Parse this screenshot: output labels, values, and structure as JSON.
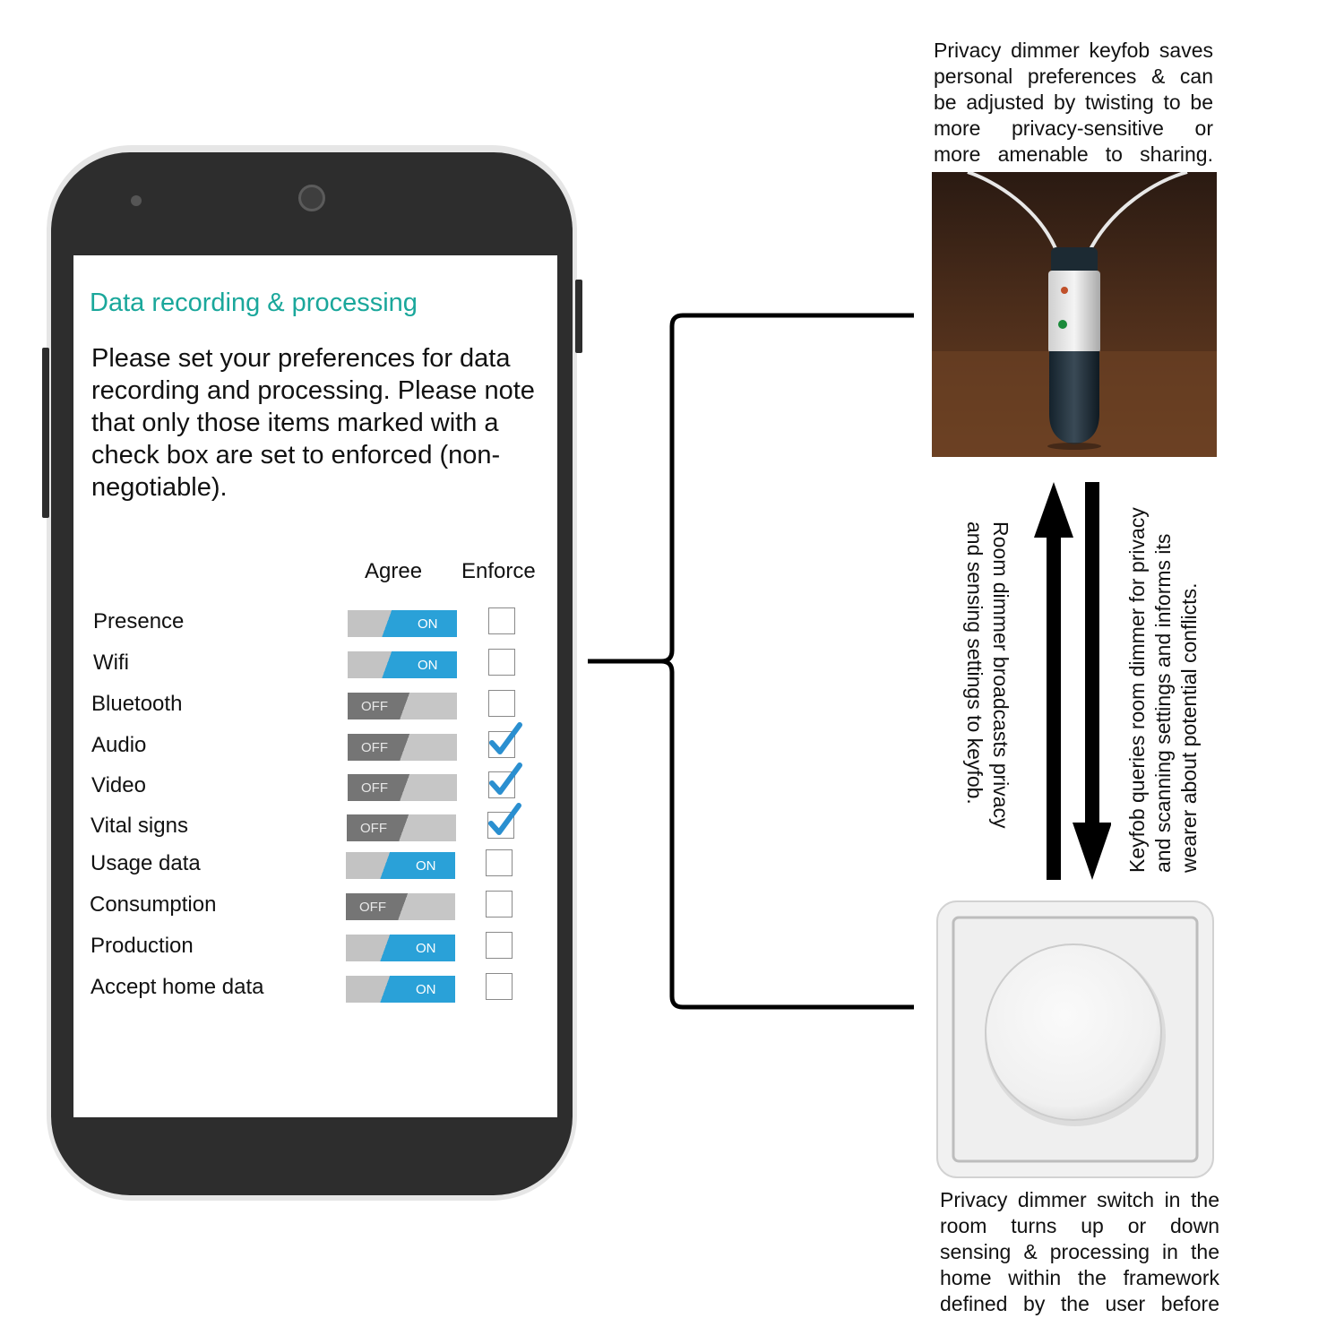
{
  "screen": {
    "title": "Data recording & processing",
    "description": "Please set your preferences for data recording and processing. Please note that only those items marked with a check box are set to enforced (non-negotiable).",
    "columns": {
      "agree": "Agree",
      "enforce": "Enforce"
    },
    "rows": [
      {
        "label": "Presence",
        "agree": "ON",
        "enforce": false
      },
      {
        "label": "Wifi",
        "agree": "ON",
        "enforce": false
      },
      {
        "label": "Bluetooth",
        "agree": "OFF",
        "enforce": false
      },
      {
        "label": "Audio",
        "agree": "OFF",
        "enforce": true
      },
      {
        "label": "Video",
        "agree": "OFF",
        "enforce": true
      },
      {
        "label": "Vital signs",
        "agree": "OFF",
        "enforce": true
      },
      {
        "label": "Usage data",
        "agree": "ON",
        "enforce": false
      },
      {
        "label": "Consumption",
        "agree": "OFF",
        "enforce": false
      },
      {
        "label": "Production",
        "agree": "ON",
        "enforce": false
      },
      {
        "label": "Accept home data",
        "agree": "ON",
        "enforce": false
      }
    ]
  },
  "keyfob": {
    "caption_lines": [
      "Privacy dimmer keyfob saves",
      "personal preferences & can",
      "be adjusted by twisting to be",
      "more privacy-sensitive or",
      "more amenable to sharing."
    ]
  },
  "dimmer": {
    "caption_lines": [
      "Privacy dimmer switch in the",
      "room turns up or down",
      "sensing & processing in the",
      "home within the framework",
      "defined by the user before"
    ]
  },
  "arrows": {
    "up_text_lines": [
      "Room dimmer broadcasts privacy",
      "and sensing settings to keyfob."
    ],
    "down_text_lines": [
      "Keyfob queries room dimmer for privacy",
      "and scanning settings and informs its",
      "wearer about potential conflicts."
    ]
  },
  "colors": {
    "title_accent": "#1aa79b",
    "toggle_on": "#2aa1d8",
    "toggle_off": "#757575",
    "checkmark": "#2a8fd0",
    "phone_body": "#2d2d2d"
  }
}
